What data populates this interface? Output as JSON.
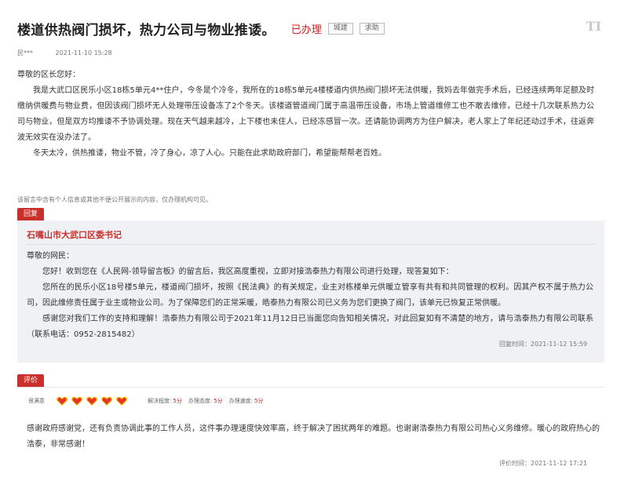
{
  "header": {
    "title": "楼道供热阀门损坏，热力公司与物业推诿。",
    "status": "已办理",
    "tags": [
      "城建",
      "求助"
    ]
  },
  "meta": {
    "author": "民***",
    "date": "2021-11-10 15:28"
  },
  "letter": {
    "greeting": "尊敬的区长您好：",
    "paragraphs": [
      "我是大武口区民乐小区18栋5单元4**住户，今冬是个冷冬，我所在的18栋5单元4楼楼道内供热阀门损坏无法供暖，我妈去年做完手术后，已经连续两年足额及时缴纳供暖费与物业费，但因该阀门损坏无人处理带压设备冻了2个冬天。该楼道管道阀门属于高温带压设备，市场上管道维修工也不敢去维修，已经十几次联系热力公司与物业，但是双方均推诿不予协调处理。现在天气越来越冷，上下楼也未住人，已经冻感冒一次。还请能协调两方为住户解决，老人家上了年纪还动过手术，往返奔波无效实在没办法了。",
      "冬天太冷，供热推诿，物业不管，冷了身心，凉了人心。只能在此求助政府部门，希望能帮帮老百姓。"
    ]
  },
  "notice": "该留言中含有个人信息或其他不便公开展示的内容，仅办理机构可见。",
  "reply": {
    "badge": "回复",
    "org": "石嘴山市大武口区委书记",
    "greeting": "尊敬的网民：",
    "paragraphs": [
      "您好！收到您在《人民网-领导留言板》的留言后，我区高度重视，立即对接浩泰热力有限公司进行处理，现答复如下：",
      "您所在的民乐小区18号楼5单元，楼道阀门损坏，按照《民法典》的有关规定，业主对栋楼单元供暖立管享有共有和共同管理的权利。因其产权不属于热力公司，因此维修责任属于业主或物业公司。为了保障您们的正常采暖，皓泰热力有限公司已义务为您们更换了阀门，该单元已恢复正常供暖。",
      "感谢您对我们工作的支持和理解！浩泰热力有限公司于2021年11月12日已当面您向告知相关情况，对此回复如有不清楚的地方，请与浩泰热力有限公司联系（联系电话：0952-2815482）"
    ],
    "time": "回复时间：2021-11-12 15:59"
  },
  "rating": {
    "badge": "评价",
    "level": "很满意",
    "hearts": 5,
    "heart_color": "#e8332a",
    "heart_accent": "#f5b800",
    "items": [
      {
        "label": "解决程度:",
        "score": "5分"
      },
      {
        "label": "办理态度:",
        "score": "5分"
      },
      {
        "label": "办理速度:",
        "score": "5分"
      }
    ],
    "text": "感谢政府感谢党，还有负责协调此事的工作人员，这件事办理速度快效率高，终于解决了困扰两年的难题。也谢谢浩泰热力有限公司热心义务维修。暖心的政府热心的浩泰，非常感谢！",
    "time": "评价时间：2021-11-12 17:21"
  },
  "icons": {
    "corner": "TI"
  }
}
